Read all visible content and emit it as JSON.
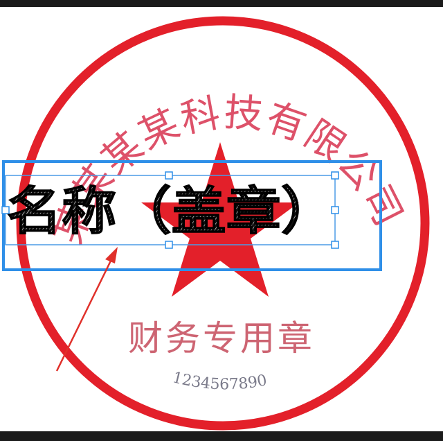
{
  "seal": {
    "company_text": "某某某某科技有限公司",
    "department_text": "财务专用章",
    "serial_number": "1234567890",
    "seal_color": "#e3202a",
    "star_icon": "star-icon"
  },
  "text_layer": {
    "label": "名称（盖章）",
    "selection_color": "#2f8fe8",
    "handle_icon": "square-handle-icon"
  },
  "annotation": {
    "arrow_icon": "arrow-icon",
    "arrow_color": "#e0302a"
  }
}
